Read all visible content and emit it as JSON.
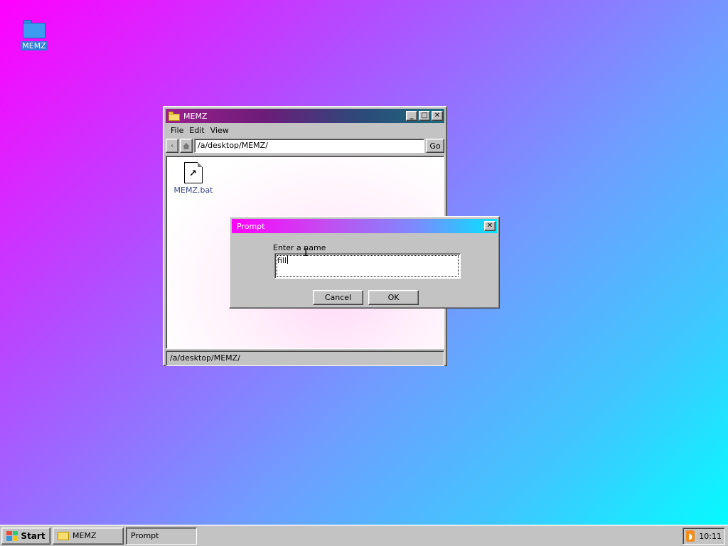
{
  "desktop": {
    "icons": [
      {
        "label": "MEMZ",
        "icon": "folder-icon"
      }
    ]
  },
  "explorer": {
    "title": "MEMZ",
    "menu": [
      "File",
      "Edit",
      "View"
    ],
    "back_label": "‹",
    "address": "/a/desktop/MEMZ/",
    "go_label": "Go",
    "files": [
      {
        "name": "MEMZ.bat",
        "icon": "shortcut-file-icon"
      }
    ],
    "status": "/a/desktop/MEMZ/"
  },
  "prompt": {
    "title": "Prompt",
    "label": "Enter a name",
    "input_value": "fill",
    "cancel_label": "Cancel",
    "ok_label": "OK"
  },
  "taskbar": {
    "start_label": "Start",
    "tasks": [
      "MEMZ",
      "Prompt"
    ],
    "clock": "10:11"
  }
}
